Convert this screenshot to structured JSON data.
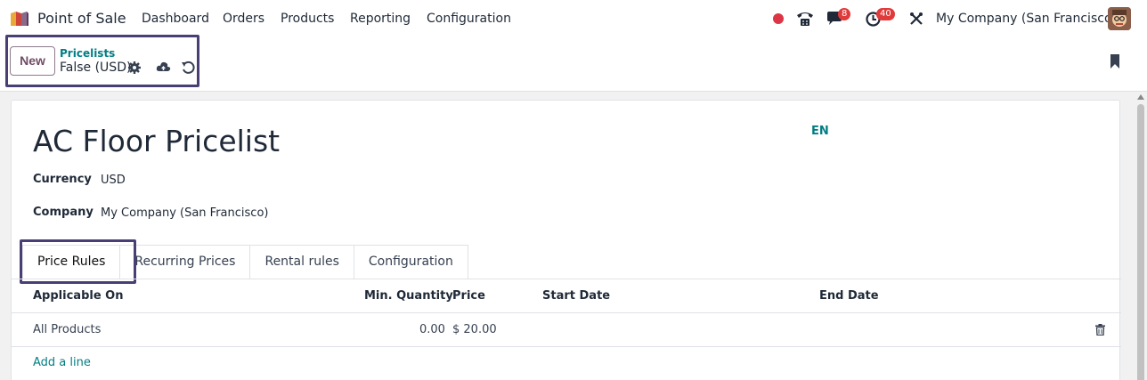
{
  "app": {
    "name": "Point of Sale",
    "logo_icon": "odoo-pos-logo-icon"
  },
  "menu": [
    "Dashboard",
    "Orders",
    "Products",
    "Reporting",
    "Configuration"
  ],
  "systray": {
    "messages_badge": "8",
    "activities_badge": "40",
    "company": "My Company (San Francisco)"
  },
  "control_panel": {
    "new_label": "New",
    "breadcrumb_parent": "Pricelists",
    "breadcrumb_current": "False (USD)"
  },
  "form": {
    "title": "AC Floor Pricelist",
    "lang": "EN",
    "fields": [
      {
        "label": "Currency",
        "value": "USD"
      },
      {
        "label": "Company",
        "value": "My Company (San Francisco)"
      }
    ],
    "tabs": [
      "Price Rules",
      "Recurring Prices",
      "Rental rules",
      "Configuration"
    ],
    "columns": [
      "Applicable On",
      "Min. Quantity",
      "Price",
      "Start Date",
      "End Date"
    ],
    "rows": [
      {
        "applicable_on": "All Products",
        "min_qty": "0.00",
        "price": "$ 20.00",
        "start": "",
        "end": ""
      }
    ],
    "add_line": "Add a line"
  },
  "colors": {
    "brand": "#714b67",
    "link": "#017e84",
    "highlight": "#4a3f75",
    "badge": "#e03a3a"
  }
}
